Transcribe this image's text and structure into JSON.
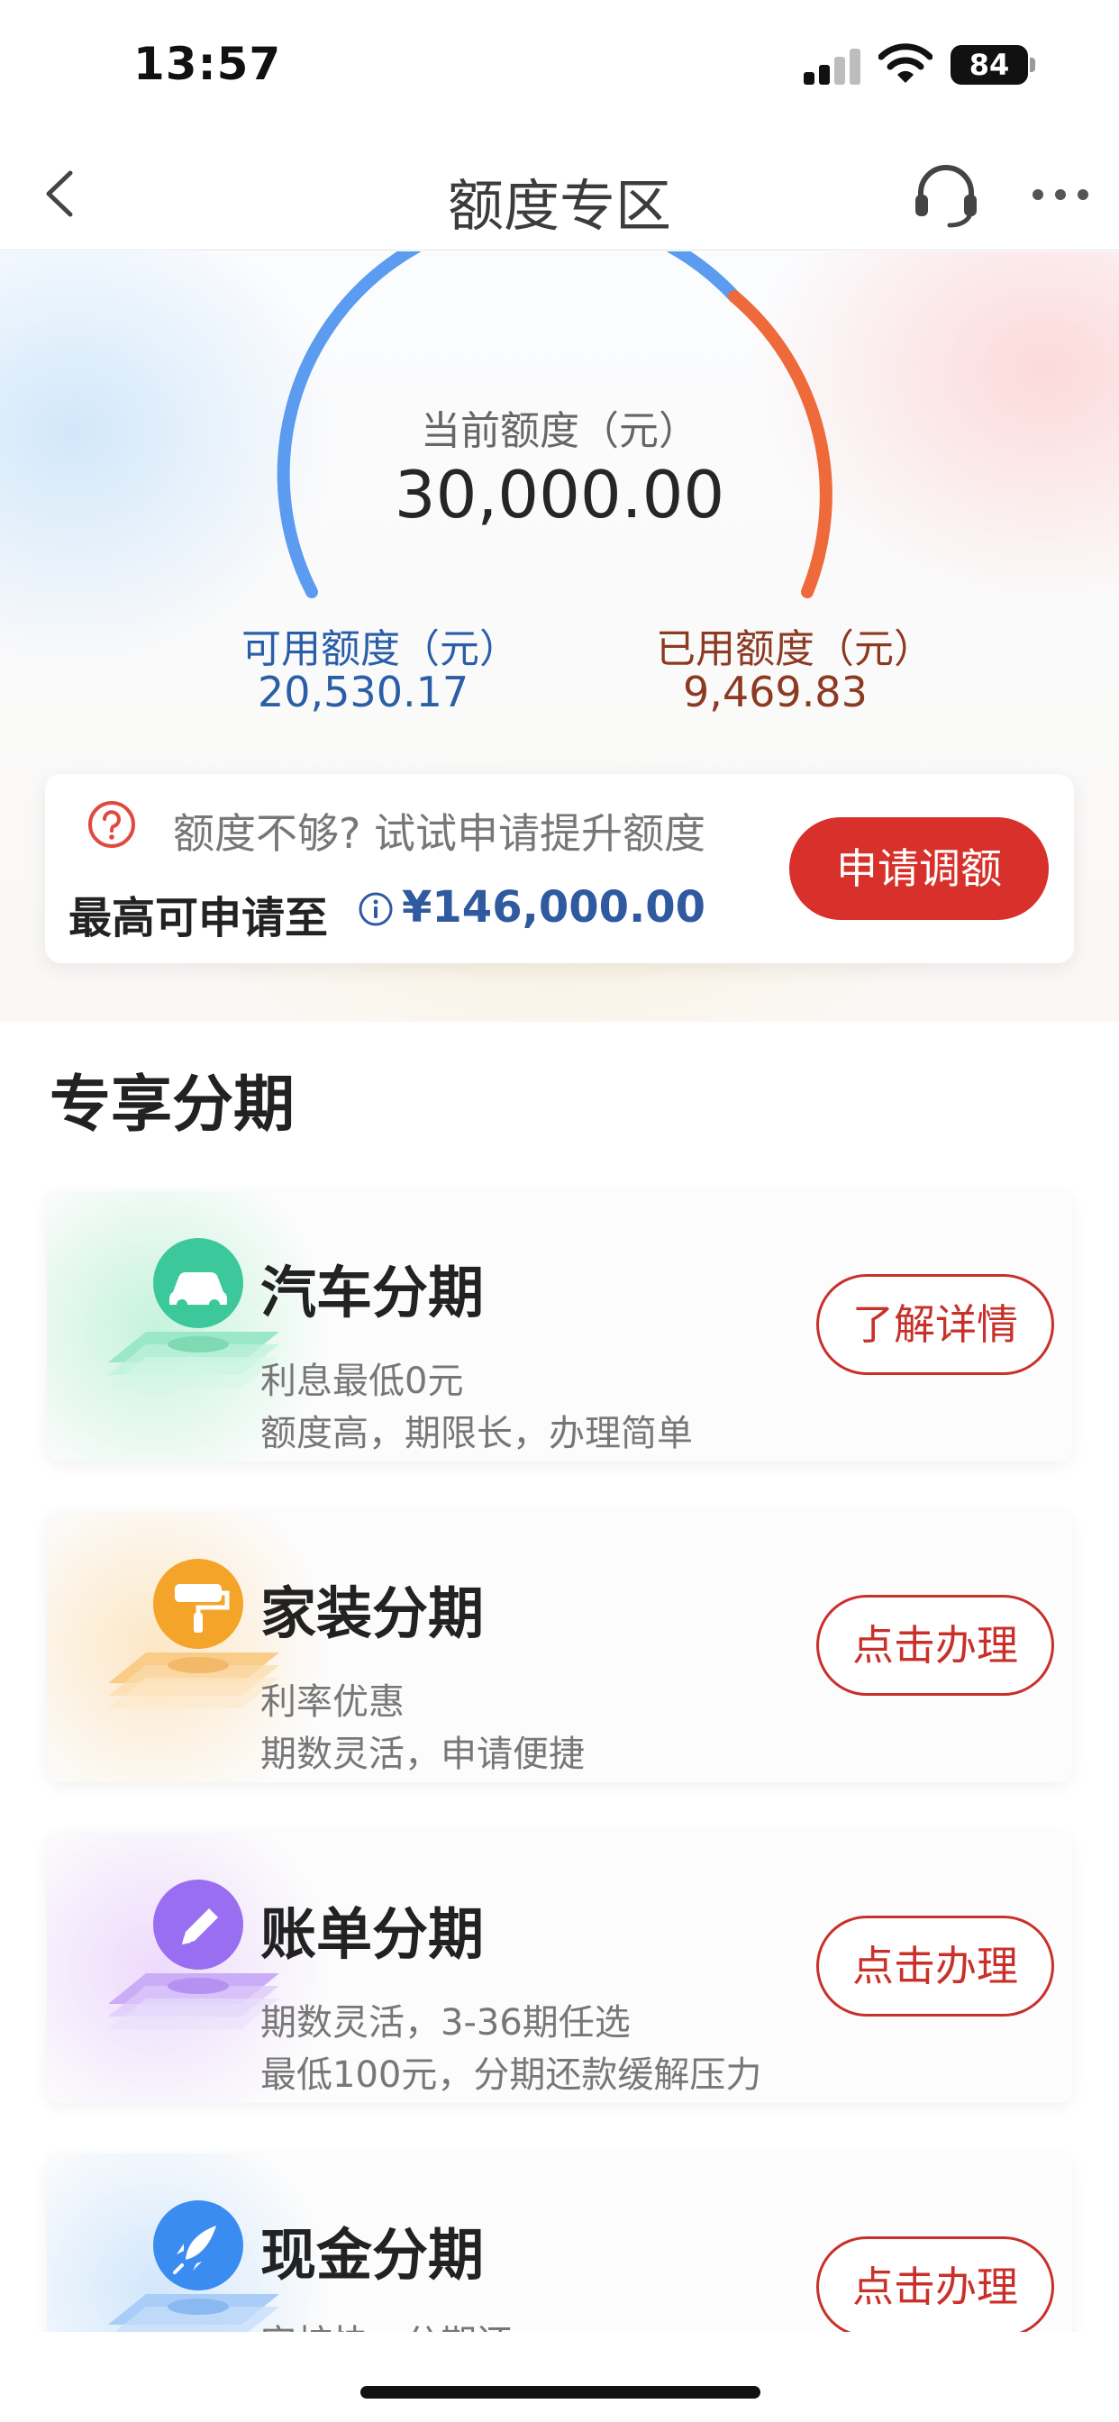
{
  "status_bar": {
    "time": "13:57",
    "battery": "84"
  },
  "nav": {
    "title": "额度专区",
    "back_icon": "chevron-left-icon",
    "service_icon": "headset-icon",
    "more_icon": "more-dots-icon"
  },
  "quota": {
    "current_label": "当前额度（元）",
    "current_value": "30,000.00",
    "available_label": "可用额度（元）",
    "available_value": "20,530.17",
    "used_label": "已用额度（元）",
    "used_value": "9,469.83",
    "gauge_colors": {
      "available": "#5b9bf0",
      "used": "#ef6a3a"
    }
  },
  "limit_card": {
    "prompt": "额度不够? 试试申请提升额度",
    "max_label": "最高可申请至",
    "max_value": "¥146,000.00",
    "apply_button": "申请调额"
  },
  "section": {
    "title": "专享分期"
  },
  "plans": [
    {
      "title": "汽车分期",
      "desc1": "利息最低0元",
      "desc2": "额度高，期限长，办理简单",
      "button": "了解详情",
      "icon": "car-icon",
      "color": "#3cc89a"
    },
    {
      "title": "家装分期",
      "desc1": "利率优惠",
      "desc2": "期数灵活，申请便捷",
      "button": "点击办理",
      "icon": "paint-roller-icon",
      "color": "#f5a42a"
    },
    {
      "title": "账单分期",
      "desc1": "期数灵活，3-36期任选",
      "desc2": "最低100元，分期还款缓解压力",
      "button": "点击办理",
      "icon": "pen-icon",
      "color": "#9a6ef0"
    },
    {
      "title": "现金分期",
      "desc1": "审核快，分期还",
      "desc2": "",
      "button": "点击办理",
      "icon": "rocket-icon",
      "color": "#3b8cf0"
    }
  ],
  "colors": {
    "primary_red": "#d8302a",
    "link_blue": "#2f5aa0"
  }
}
